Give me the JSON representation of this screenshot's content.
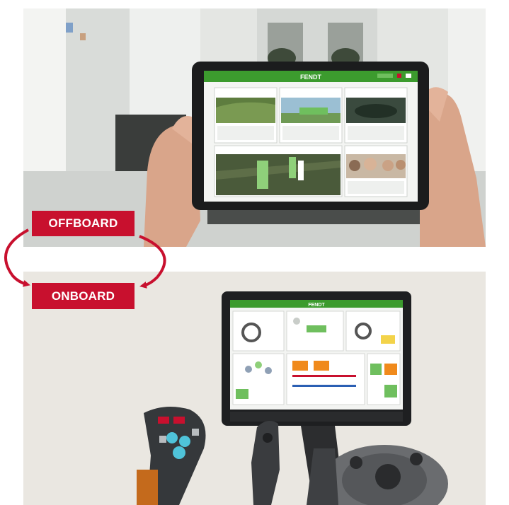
{
  "labels": {
    "offboard": "OFFBOARD",
    "onboard": "ONBOARD"
  },
  "tablet": {
    "brand": "FENDT"
  },
  "terminal": {
    "brand": "FENDT"
  },
  "colors": {
    "accent_red": "#c8102e",
    "fendt_green": "#3c9b2e"
  },
  "icons": [
    "cycle-arrow-icon"
  ]
}
